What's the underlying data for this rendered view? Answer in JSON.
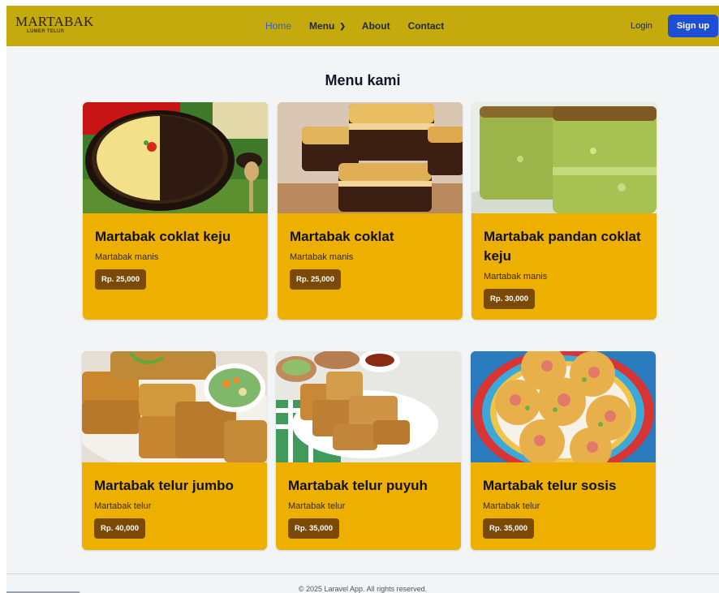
{
  "navbar": {
    "logo_main": "MARTABAK",
    "logo_sub": "LUMER TELUR",
    "links": [
      {
        "label": "Home"
      },
      {
        "label": "Menu"
      },
      {
        "label": "About"
      },
      {
        "label": "Contact"
      }
    ],
    "login_label": "Login",
    "signup_label": "Sign up"
  },
  "main": {
    "title": "Menu kami",
    "items": [
      {
        "name": "Martabak coklat keju",
        "category": "Martabak manis",
        "price": "Rp. 25,000"
      },
      {
        "name": "Martabak coklat",
        "category": "Martabak manis",
        "price": "Rp. 25,000"
      },
      {
        "name": "Martabak pandan coklat keju",
        "category": "Martabak manis",
        "price": "Rp. 30,000"
      },
      {
        "name": "Martabak telur jumbo",
        "category": "Martabak telur",
        "price": "Rp. 40,000"
      },
      {
        "name": "Martabak telur puyuh",
        "category": "Martabak telur",
        "price": "Rp. 35,000"
      },
      {
        "name": "Martabak telur sosis",
        "category": "Martabak telur",
        "price": "Rp. 35,000"
      }
    ]
  },
  "footer": {
    "text": "© 2025 Laravel App. All rights reserved."
  },
  "colors": {
    "navbar": "#c4aa0c",
    "card": "#edb000",
    "price_button": "#7a4a06",
    "signup_button": "#1d4ed8",
    "active_link": "#2f5fd6"
  }
}
